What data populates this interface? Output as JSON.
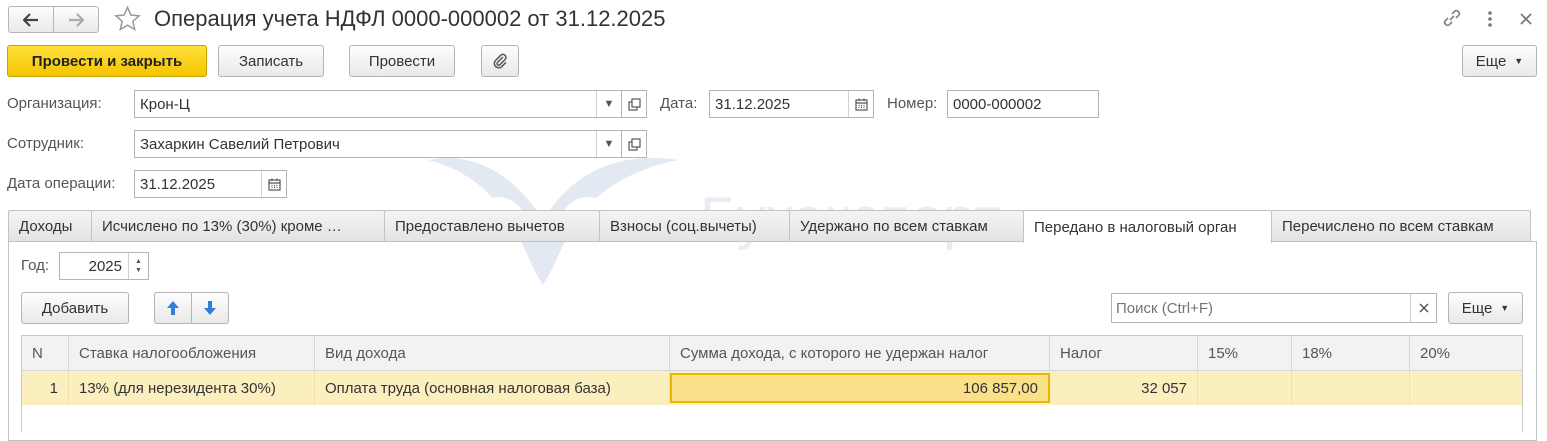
{
  "window": {
    "title": "Операция учета НДФЛ 0000-000002 от 31.12.2025"
  },
  "toolbar": {
    "post_close_label": "Провести и закрыть",
    "save_label": "Записать",
    "post_label": "Провести",
    "more_label": "Еще"
  },
  "form": {
    "org_label": "Организация:",
    "org_value": "Крон-Ц",
    "date_label": "Дата:",
    "date_value": "31.12.2025",
    "number_label": "Номер:",
    "number_value": "0000-000002",
    "employee_label": "Сотрудник:",
    "employee_value": "Захаркин Савелий Петрович",
    "op_date_label": "Дата операции:",
    "op_date_value": "31.12.2025"
  },
  "tabs": [
    {
      "label": "Доходы"
    },
    {
      "label": "Исчислено по 13% (30%) кроме …"
    },
    {
      "label": "Предоставлено вычетов"
    },
    {
      "label": "Взносы (соц.вычеты)"
    },
    {
      "label": "Удержано по всем ставкам"
    },
    {
      "label": "Передано в налоговый орган",
      "active": true
    },
    {
      "label": "Перечислено по всем ставкам"
    }
  ],
  "tab_content": {
    "year_label": "Год:",
    "year_value": "2025",
    "add_label": "Добавить",
    "search_placeholder": "Поиск (Ctrl+F)",
    "more_label": "Еще"
  },
  "grid": {
    "columns": [
      "N",
      "Ставка налогообложения",
      "Вид дохода",
      "Сумма дохода, с которого не удержан налог",
      "Налог",
      "15%",
      "18%",
      "20%"
    ],
    "rows": [
      {
        "n": "1",
        "rate": "13% (для нерезидента 30%)",
        "income_type": "Оплата труда (основная налоговая база)",
        "amount": "106 857,00",
        "tax": "32 057",
        "p15": "",
        "p18": "",
        "p20": ""
      }
    ]
  },
  "watermark": {
    "text": "Бухэкспорт"
  },
  "colors": {
    "primary_button": "#f5c400",
    "selected_row": "#fbefc0",
    "active_cell": "#fbe08a",
    "active_cell_border": "#e8b800",
    "arrow_blue": "#2f7fd6"
  }
}
